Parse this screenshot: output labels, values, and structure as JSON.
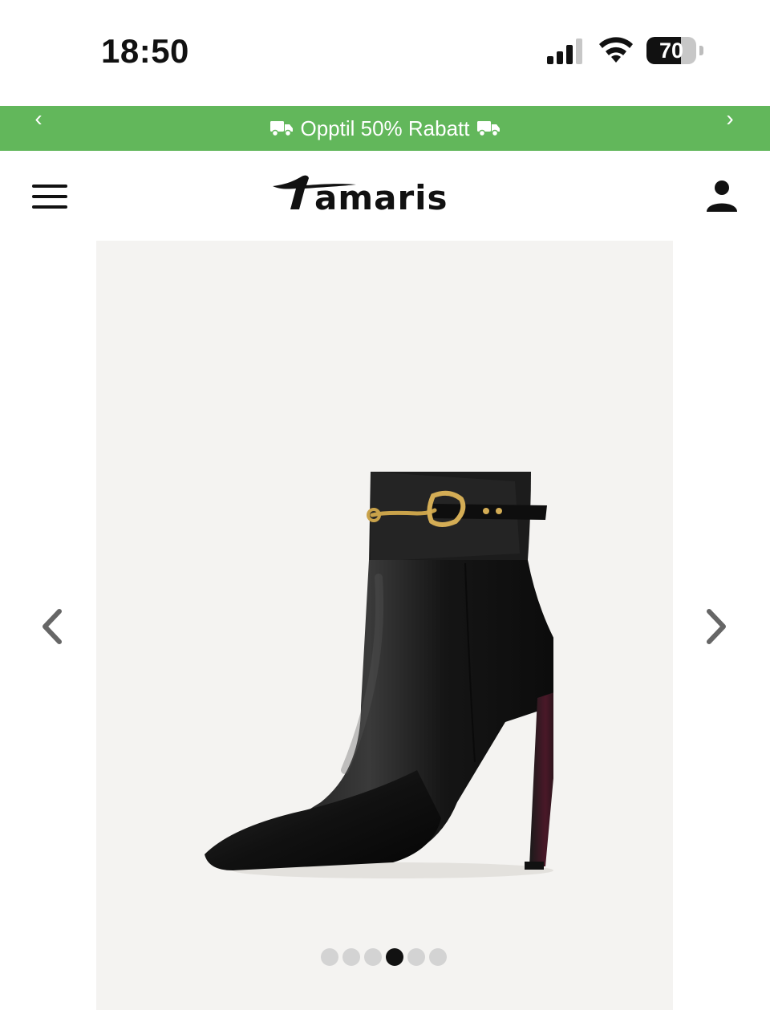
{
  "status_bar": {
    "time": "18:50",
    "battery_level": "70",
    "icons": [
      "signal-icon",
      "wifi-icon",
      "battery-icon"
    ]
  },
  "promo_banner": {
    "text": "Opptil 50% Rabatt",
    "background": "#62b75b",
    "icons": [
      "chevron-left-icon",
      "truck-icon",
      "truck-icon",
      "chevron-right-icon"
    ]
  },
  "header": {
    "logo_text": "Tamaris",
    "icons": [
      "hamburger-menu-icon",
      "user-icon"
    ]
  },
  "gallery": {
    "image_alt": "black leather ankle boot with gold chain",
    "slide_count": 6,
    "active_index": 3,
    "icons": [
      "chevron-left-icon",
      "chevron-right-icon"
    ]
  }
}
